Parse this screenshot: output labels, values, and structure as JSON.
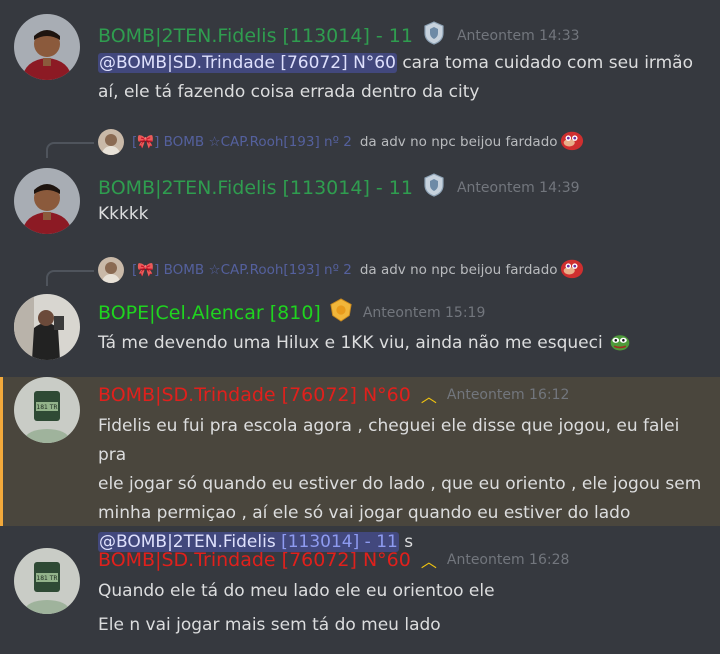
{
  "colors": {
    "background": "#36393f",
    "fidelis_name": "#2f9d4f",
    "bope_name": "#1fd41f",
    "trindade_name": "#e0201c",
    "reply_name": "#5865a8",
    "highlight_bar": "#f2a93b",
    "mention_bg": "#5865f2"
  },
  "messages": [
    {
      "author": "BOMB|2TEN.Fidelis [113014] - 11",
      "timestamp": "Anteontem 14:33",
      "badge_icon": "shield-badge-icon",
      "mention": "@BOMB|SD.Trindade [76072] N°60",
      "text_after_mention": " cara toma cuidado com seu irmão",
      "line2": "aí, ele tá fazendo coisa errada dentro da city"
    },
    {
      "reply": {
        "author": "[🎀] BOMB ☆CAP.Rooh[193] nº 2",
        "text": "da adv no npc beijou fardado"
      },
      "author": "BOMB|2TEN.Fidelis [113014] - 11",
      "timestamp": "Anteontem 14:39",
      "badge_icon": "shield-badge-icon",
      "text": "Kkkkk"
    },
    {
      "reply": {
        "author": "[🎀] BOMB ☆CAP.Rooh[193] nº 2",
        "text": "da adv no npc beijou fardado"
      },
      "author": "BOPE|Cel.Alencar [810]",
      "timestamp": "Anteontem 15:19",
      "badge_icon": "gold-badge-icon",
      "text": "Tá me devendo uma Hilux e 1KK viu, ainda não me esqueci"
    },
    {
      "author": "BOMB|SD.Trindade [76072] N°60",
      "timestamp": "Anteontem 16:12",
      "badge_icon": "chevron-up-icon",
      "lines": [
        "Fidelis eu fui pra escola agora , cheguei ele disse que jogou,  eu falei pra",
        "ele jogar só quando eu estiver do lado , que eu oriento , ele jogou sem",
        "minha permiçao , aí ele só vai jogar quando eu estiver do lado"
      ],
      "mention_a": "@BOMB|2TEN.Fidelis",
      "mention_b": " [113014] - 11",
      "after_mention": " s"
    },
    {
      "author": "BOMB|SD.Trindade [76072] N°60",
      "timestamp": "Anteontem 16:28",
      "badge_icon": "chevron-up-icon",
      "line1": "Quando ele tá do meu lado ele eu orientoo ele",
      "line2": "Ele n vai jogar mais sem tá do meu lado"
    }
  ]
}
